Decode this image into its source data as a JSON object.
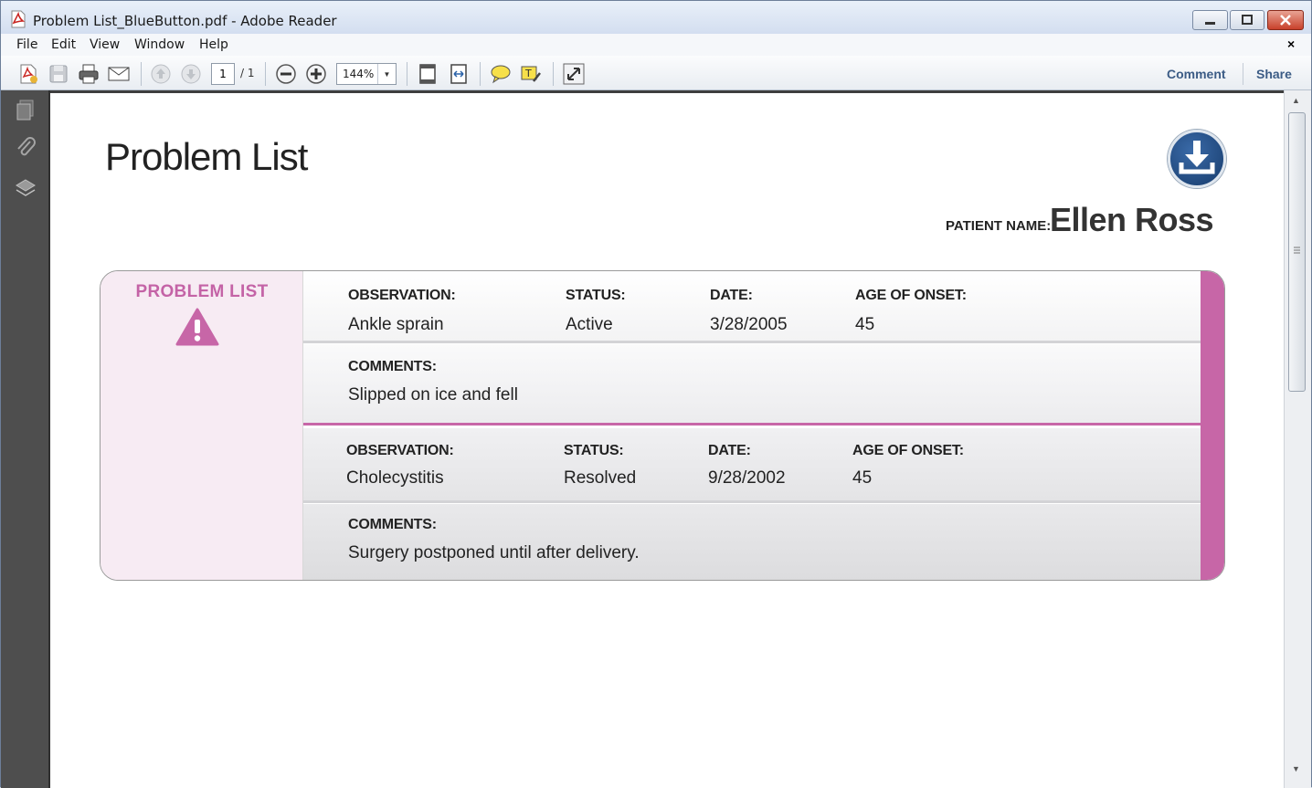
{
  "window": {
    "title": "Problem List_BlueButton.pdf - Adobe Reader",
    "minimize_label": "",
    "maximize_label": "",
    "close_label": ""
  },
  "menu": {
    "items": [
      "File",
      "Edit",
      "View",
      "Window",
      "Help"
    ],
    "close_doc": "×"
  },
  "toolbar": {
    "page_current": "1",
    "page_total": "/ 1",
    "zoom": "144%",
    "comment_label": "Comment",
    "share_label": "Share",
    "icons": [
      "create-pdf-icon",
      "save-icon",
      "print-icon",
      "email-icon",
      "page-up-icon",
      "page-down-icon",
      "zoom-out-icon",
      "zoom-in-icon",
      "fit-page-icon",
      "fit-width-icon",
      "comment-bubble-icon",
      "highlight-icon",
      "fullscreen-icon"
    ]
  },
  "leftnav": {
    "icons": [
      "pages-icon",
      "attachment-icon",
      "layers-icon"
    ]
  },
  "document": {
    "title": "Problem List",
    "patient_label": "PATIENT NAME:",
    "patient_name": "Ellen Ross",
    "section_title": "PROBLEM LIST",
    "labels": {
      "observation": "OBSERVATION:",
      "status": "STATUS:",
      "date": "DATE:",
      "age": "AGE OF ONSET:",
      "comments": "COMMENTS:"
    },
    "problems": [
      {
        "observation": "Ankle sprain",
        "status": "Active",
        "date": "3/28/2005",
        "age": "45",
        "comments": "Slipped on ice and fell"
      },
      {
        "observation": "Cholecystitis",
        "status": "Resolved",
        "date": "9/28/2002",
        "age": "45",
        "comments": "Surgery postponed until after delivery."
      }
    ]
  },
  "colors": {
    "accent_pink": "#c766a7",
    "side_bg": "#f7ebf3",
    "link_blue": "#3c5c86",
    "download_blue": "#173c6c"
  }
}
